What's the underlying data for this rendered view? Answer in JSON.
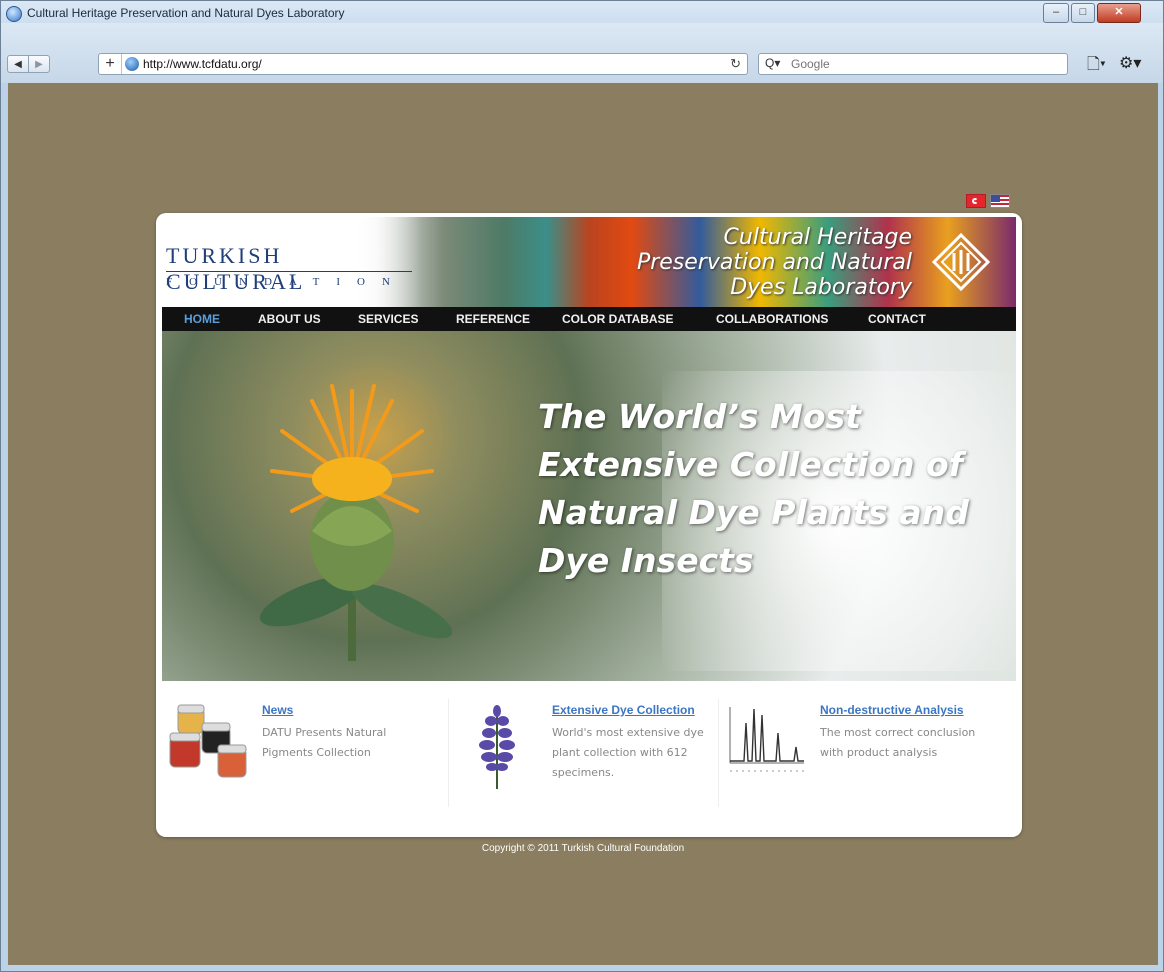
{
  "window": {
    "title": "Cultural Heritage Preservation and Natural Dyes Laboratory",
    "controls": {
      "minimize": "–",
      "maximize": "□",
      "close": "✕"
    }
  },
  "toolbar": {
    "back": "◀",
    "forward": "▶",
    "add": "+",
    "url": "http://www.tcfdatu.org/",
    "reload": "↻",
    "search_icon": "Q▾",
    "search_placeholder": "Google",
    "page_menu": "🗋▾",
    "tools_menu": "⚙▾"
  },
  "site": {
    "logo_top": "TURKISH CULTURAL",
    "logo_bottom": "FOUNDATION",
    "lab_title": [
      "Cultural Heritage",
      "Preservation and Natural",
      "Dyes Laboratory"
    ],
    "menu": [
      "HOME",
      "ABOUT US",
      "SERVICES",
      "REFERENCE",
      "COLOR DATABASE",
      "COLLABORATIONS",
      "CONTACT"
    ],
    "active_menu": "HOME",
    "hero_text": [
      "The World’s Most",
      "Extensive Collection of",
      "Natural Dye Plants and",
      "Dye Insects"
    ],
    "features": [
      {
        "title": "News",
        "desc": "DATU Presents Natural Pigments Collection",
        "icon": "pigment-jars-icon"
      },
      {
        "title": "Extensive Dye Collection",
        "desc": "World's most extensive dye plant collection with 612 specimens.",
        "icon": "dye-plant-icon"
      },
      {
        "title": "Non-destructive Analysis",
        "desc": "The most correct conclusion with product analysis",
        "icon": "chromatogram-icon"
      }
    ],
    "copyright": "Copyright © 2011 Turkish Cultural Foundation"
  },
  "colors": {
    "page_bg": "#8a7d60",
    "menu_bg": "#111111",
    "link": "#3b76c4",
    "active": "#5b9fdc"
  }
}
